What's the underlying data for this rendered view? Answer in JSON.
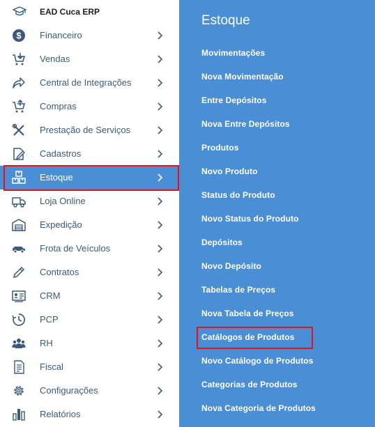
{
  "brand": {
    "title": "EAD Cuca ERP",
    "icon": "graduation-cap-icon"
  },
  "menu": {
    "items": [
      {
        "label": "Financeiro",
        "icon": "dollar-icon"
      },
      {
        "label": "Vendas",
        "icon": "cart-icon"
      },
      {
        "label": "Central de Integrações",
        "icon": "share-icon"
      },
      {
        "label": "Compras",
        "icon": "cart-download-icon"
      },
      {
        "label": "Prestação de Serviços",
        "icon": "tools-icon"
      },
      {
        "label": "Cadastros",
        "icon": "edit-icon"
      },
      {
        "label": "Estoque",
        "icon": "boxes-icon",
        "active": true
      },
      {
        "label": "Loja Online",
        "icon": "truck-icon"
      },
      {
        "label": "Expedição",
        "icon": "warehouse-icon"
      },
      {
        "label": "Frota de Veículos",
        "icon": "car-icon"
      },
      {
        "label": "Contratos",
        "icon": "pen-icon"
      },
      {
        "label": "CRM",
        "icon": "contact-card-icon"
      },
      {
        "label": "PCP",
        "icon": "clock-icon"
      },
      {
        "label": "RH",
        "icon": "users-icon"
      },
      {
        "label": "Fiscal",
        "icon": "document-icon"
      },
      {
        "label": "Configurações",
        "icon": "gear-icon"
      },
      {
        "label": "Relatórios",
        "icon": "bar-chart-icon"
      }
    ]
  },
  "submenu": {
    "title": "Estoque",
    "items": [
      "Movimentações",
      "Nova Movimentação",
      "Entre Depósitos",
      "Nova Entre Depósitos",
      "Produtos",
      "Novo Produto",
      "Status do Produto",
      "Novo Status do Produto",
      "Depósitos",
      "Novo Depósito",
      "Tabelas de Preços",
      "Nova Tabela de Preços",
      "Catálogos de Produtos",
      "Novo Catálogo de Produtos",
      "Categorias de Produtos",
      "Nova Categoria de Produtos"
    ]
  },
  "colors": {
    "accent": "#4a8fd6",
    "highlight": "#e3141b",
    "menu_text": "#3d5a7a",
    "icon": "#3d5a7a"
  }
}
